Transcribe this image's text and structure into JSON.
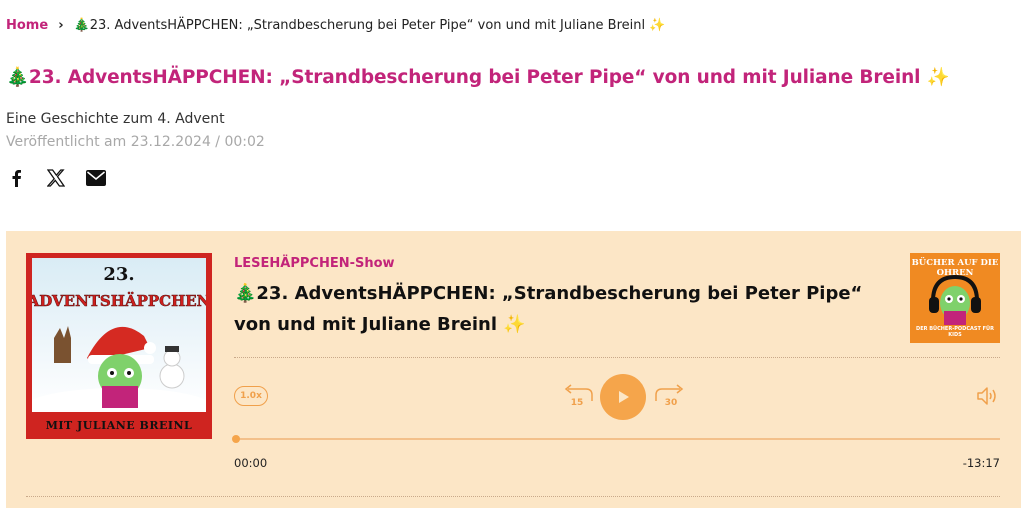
{
  "breadcrumb": {
    "home": "Home",
    "separator": "›",
    "current": "🎄23. AdventsHÄPPCHEN: „Strandbescherung bei Peter Pipe“ von und mit Juliane Breinl ✨"
  },
  "page": {
    "title": "🎄23. AdventsHÄPPCHEN: „Strandbescherung bei Peter Pipe“ von und mit Juliane Breinl ✨",
    "subtitle": "Eine Geschichte zum 4. Advent",
    "published": "Veröffentlicht am 23.12.2024 / 00:02"
  },
  "share": {
    "icons": [
      "facebook-icon",
      "x-icon",
      "mail-icon"
    ]
  },
  "player": {
    "show_name": "LESEHÄPPCHEN-Show",
    "episode_title": "🎄23. AdventsHÄPPCHEN: „Strandbescherung bei Peter Pipe“ von und mit Juliane Breinl ✨",
    "cover": {
      "number": "23.",
      "headline": "ADVENTSHÄPPCHEN",
      "footer": "MIT JULIANE BREINL"
    },
    "podcast_logo": {
      "top": "BÜCHER AUF DIE OHREN",
      "bottom": "DER BÜCHER-PODCAST FÜR KIDS"
    },
    "speed": "1.0x",
    "rewind_seconds": "15",
    "forward_seconds": "30",
    "time_current": "00:00",
    "time_remaining": "-13:17",
    "progress": 0,
    "accent_color": "#f5a54b",
    "brand_color": "#c2247a",
    "background_color": "#fce6c6"
  }
}
